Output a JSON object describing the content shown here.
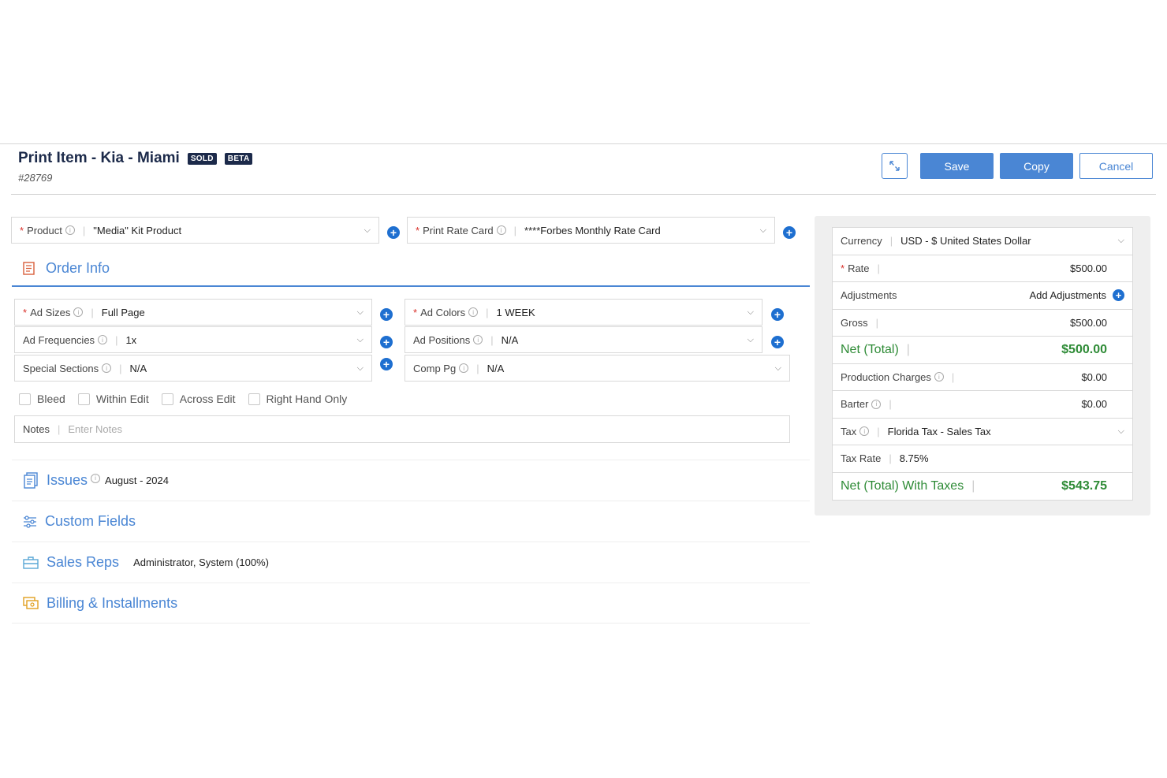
{
  "header": {
    "title": "Print Item - Kia - Miami",
    "badges": [
      "SOLD",
      "BETA"
    ],
    "record_id": "#28769"
  },
  "actions": {
    "save": "Save",
    "copy": "Copy",
    "cancel": "Cancel"
  },
  "top_fields": {
    "product": {
      "label": "Product",
      "value": "\"Media\" Kit Product"
    },
    "rate_card": {
      "label": "Print Rate Card",
      "value": "****Forbes Monthly Rate Card"
    }
  },
  "order_info": {
    "title": "Order Info",
    "ad_sizes": {
      "label": "Ad Sizes",
      "value": "Full Page"
    },
    "ad_colors": {
      "label": "Ad Colors",
      "value": "1 WEEK"
    },
    "ad_frequencies": {
      "label": "Ad Frequencies",
      "value": "1x"
    },
    "ad_positions": {
      "label": "Ad Positions",
      "value": "N/A"
    },
    "special_sections": {
      "label": "Special Sections",
      "value": "N/A"
    },
    "comp_pg": {
      "label": "Comp Pg",
      "value": "N/A"
    },
    "checkboxes": [
      "Bleed",
      "Within Edit",
      "Across Edit",
      "Right Hand Only"
    ],
    "notes": {
      "label": "Notes",
      "placeholder": "Enter Notes"
    }
  },
  "sections": {
    "issues": {
      "title": "Issues",
      "value": "August - 2024"
    },
    "custom_fields": {
      "title": "Custom Fields"
    },
    "sales_reps": {
      "title": "Sales Reps",
      "value": "Administrator, System (100%)"
    },
    "billing": {
      "title": "Billing & Installments"
    }
  },
  "pricing": {
    "currency": {
      "label": "Currency",
      "value": "USD - $ United States Dollar"
    },
    "rate": {
      "label": "Rate",
      "value": "$500.00"
    },
    "adjustments": {
      "label": "Adjustments",
      "value": "Add Adjustments"
    },
    "gross": {
      "label": "Gross",
      "value": "$500.00"
    },
    "net_total": {
      "label": "Net (Total)",
      "value": "$500.00"
    },
    "production_charges": {
      "label": "Production Charges",
      "value": "$0.00"
    },
    "barter": {
      "label": "Barter",
      "value": "$0.00"
    },
    "tax": {
      "label": "Tax",
      "value": "Florida Tax - Sales Tax"
    },
    "tax_rate": {
      "label": "Tax Rate",
      "value": "8.75%"
    },
    "net_with_taxes": {
      "label": "Net (Total) With Taxes",
      "value": "$543.75"
    }
  },
  "colors": {
    "accent": "#4a86d4",
    "navy": "#1c2a4a",
    "green": "#2e8b36",
    "required": "#d9312b"
  }
}
